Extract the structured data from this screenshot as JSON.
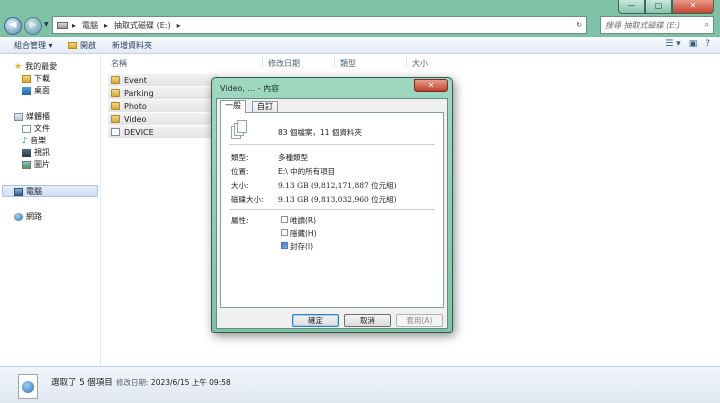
{
  "window": {
    "caption_minimize": "—",
    "caption_maximize": "▢",
    "caption_close": "✕"
  },
  "address": {
    "back": "◀",
    "forward": "▶",
    "recent": "▼",
    "crumb_sep1": "▸",
    "crumb1": "電腦",
    "crumb_sep2": "▸",
    "crumb2": "抽取式磁碟 (E:)",
    "crumb_sep3": "▸",
    "refresh": "↻",
    "search_placeholder": "搜尋 抽取式磁碟 (E:)",
    "search_icon": "⌕"
  },
  "toolbar": {
    "organize": "組合管理 ▾",
    "open": "開啟",
    "new_folder": "新增資料夾",
    "views": "☰ ▾",
    "preview": "▣",
    "help": "?"
  },
  "nav": {
    "favorites": "我的最愛",
    "downloads": "下載",
    "desktop": "桌面",
    "libraries": "媒體櫃",
    "documents": "文件",
    "music": "音樂",
    "videos": "視訊",
    "pictures": "圖片",
    "computer": "電腦",
    "network": "網路"
  },
  "columns": {
    "name": "名稱",
    "modified": "修改日期",
    "type": "類型",
    "size": "大小"
  },
  "files": [
    {
      "name": "Event",
      "kind": "folder"
    },
    {
      "name": "Parking",
      "kind": "folder"
    },
    {
      "name": "Photo",
      "kind": "folder"
    },
    {
      "name": "Video",
      "kind": "folder"
    },
    {
      "name": "DEVICE",
      "kind": "file"
    }
  ],
  "status": {
    "selected": "選取了 5 個項目",
    "modified_label": "修改日期:",
    "modified_value": "2023/6/15 上午 09:58"
  },
  "dialog": {
    "title": "Video, ... - 內容",
    "close": "✕",
    "tab_general": "一般",
    "tab_custom": "自訂",
    "summary": "83 個檔案，11 個資料夾",
    "type_label": "類型:",
    "type_value": "多種類型",
    "location_label": "位置:",
    "location_value": "E:\\ 中的所有項目",
    "size_label": "大小:",
    "size_value": "9.13 GB (9,812,171,887 位元組)",
    "disk_size_label": "磁碟大小:",
    "disk_size_value": "9.13 GB (9,813,032,960 位元組)",
    "attributes_label": "屬性:",
    "readonly": "唯讀(R)",
    "hidden": "隱藏(H)",
    "archive": "封存(I)",
    "ok": "確定",
    "cancel": "取消",
    "apply": "套用(A)"
  }
}
